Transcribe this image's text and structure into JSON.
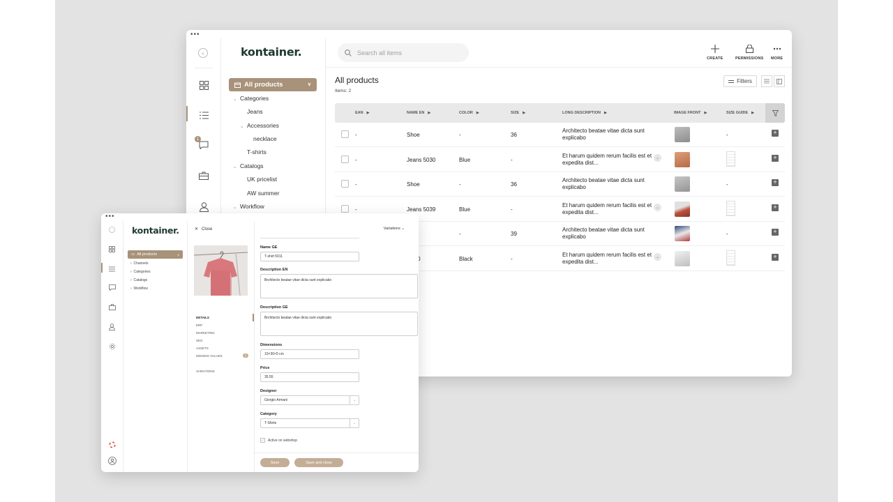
{
  "brand": "kontainer.",
  "colors": {
    "accent": "#a8927a",
    "logo": "#1f3a30",
    "backdrop": "#e3e3e3"
  },
  "window_dots": "•••",
  "main": {
    "rail_icons": [
      "back-icon",
      "grid-icon",
      "list-icon",
      "chat-icon",
      "briefcase-icon",
      "user-icon"
    ],
    "chat_badge": "1",
    "tree": {
      "selected": "All products",
      "items": [
        {
          "label": "Categories",
          "caret": "⌄"
        },
        {
          "label": "Jeans",
          "caret": ""
        },
        {
          "label": "Accessories",
          "caret": "⌄"
        },
        {
          "label": "necklace",
          "caret": ""
        },
        {
          "label": "T-shirts",
          "caret": ""
        },
        {
          "label": "Catalogs",
          "caret": "⌄"
        },
        {
          "label": "UK pricelist",
          "caret": ""
        },
        {
          "label": "AW summer",
          "caret": ""
        },
        {
          "label": "Workflow",
          "caret": "⌄"
        }
      ]
    },
    "search_placeholder": "Search all items",
    "actions": [
      {
        "label": "CREATE",
        "icon": "plus-icon"
      },
      {
        "label": "PERMISSIONS",
        "icon": "lock-icon"
      },
      {
        "label": "MORE",
        "icon": "more-icon"
      }
    ],
    "title": "All products",
    "items_count": "Items: 2",
    "filters_label": "Filters",
    "columns": [
      "EAN",
      "NAME EN",
      "COLOR",
      "SIZE",
      "LONG DESCRIPTION",
      "IMAGE FRONT",
      "SIZE GUIDE"
    ],
    "rows": [
      {
        "ean": "-",
        "name": "Shoe",
        "color": "-",
        "size": "36",
        "desc": "Architecto beatae vitae dicta sunt explicabo",
        "image": "sneaker-white",
        "guide": "-",
        "expand": false
      },
      {
        "ean": "-",
        "name": "Jeans 5030",
        "color": "Blue",
        "size": "-",
        "desc": "Et harum quidem rerum facilis est et expedita dist...",
        "image": "sneaker-orange",
        "guide": "size-grid",
        "expand": true
      },
      {
        "ean": "-",
        "name": "Shoe",
        "color": "-",
        "size": "36",
        "desc": "Architecto beatae vitae dicta sunt explicabo",
        "image": "sneaker-grey",
        "guide": "-",
        "expand": false
      },
      {
        "ean": "-",
        "name": "Jeans 5039",
        "color": "Blue",
        "size": "-",
        "desc": "Et harum quidem rerum facilis est et expedita dist...",
        "image": "sneaker-red",
        "guide": "size-grid",
        "expand": true
      },
      {
        "ean": "",
        "name": "e",
        "color": "-",
        "size": "39",
        "desc": "Architecto beatae vitae dicta sunt explicabo",
        "image": "sneaker-blue",
        "guide": "-",
        "expand": false
      },
      {
        "ean": "",
        "name": "ns 50",
        "color": "Black",
        "size": "-",
        "desc": "Et harum quidem rerum facilis est et expedita dist...",
        "image": "shoe-white",
        "guide": "size-grid",
        "expand": true
      }
    ]
  },
  "editor": {
    "tree": {
      "selected": "All products",
      "items": [
        "Channels",
        "Categories",
        "Catalogs",
        "Workflow"
      ]
    },
    "close_label": "Close",
    "variations_label": "Variations",
    "detail_nav": [
      "DETAILS",
      "ERP",
      "MARKETING",
      "SEO",
      "ASSETS",
      "MISSING VALUES",
      "VARIATIONS"
    ],
    "missing_count": "1",
    "fields": {
      "name_ge_label": "Name GE",
      "name_ge_value": "T-shirt 5011",
      "desc_en_label": "Description EN",
      "desc_en_value": "Brchitecto beatae vitae dicta sunt explicabo",
      "desc_ge_label": "Description GE",
      "desc_ge_value": "Brchitecto beatae vitae dicta sunt explicabo",
      "dimensions_label": "Dimensions",
      "dimensions_value": "10×30×5 cm",
      "price_label": "Price",
      "price_value": "35.55",
      "designer_label": "Designer",
      "designer_value": "Giorgio Armani",
      "category_label": "Category",
      "category_value": "T-Shirts",
      "webshop_label": "Active on webshop"
    },
    "save_label": "Save",
    "save_close_label": "Save and close"
  }
}
